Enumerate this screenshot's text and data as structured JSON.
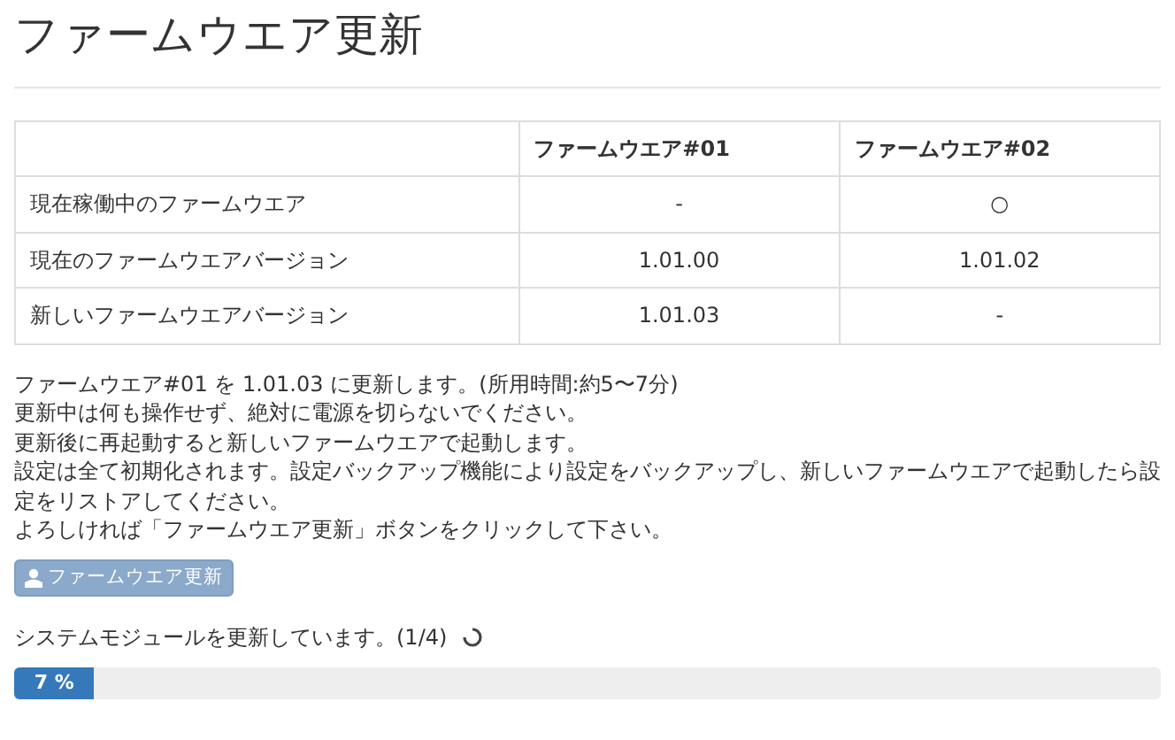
{
  "title": "ファームウエア更新",
  "table": {
    "columns": [
      "ファームウエア#01",
      "ファームウエア#02"
    ],
    "rows": [
      {
        "label": "現在稼働中のファームウエア",
        "cells": [
          "-",
          "○"
        ]
      },
      {
        "label": "現在のファームウエアバージョン",
        "cells": [
          "1.01.00",
          "1.01.02"
        ]
      },
      {
        "label": "新しいファームウエアバージョン",
        "cells": [
          "1.01.03",
          "-"
        ]
      }
    ]
  },
  "notice": [
    "ファームウエア#01 を 1.01.03 に更新します。(所用時間:約5〜7分)",
    "更新中は何も操作せず、絶対に電源を切らないでください。",
    "更新後に再起動すると新しいファームウエアで起動します。",
    "設定は全て初期化されます。設定バックアップ機能により設定をバックアップし、新しいファームウエアで起動したら設定をリストアしてください。",
    "よろしければ「ファームウエア更新」ボタンをクリックして下さい。"
  ],
  "update_button": {
    "label": "ファームウエア更新",
    "disabled": true
  },
  "status": {
    "text": "システムモジュールを更新しています。(1/4)",
    "busy": true
  },
  "progress": {
    "label": "7 %",
    "level": 0.07
  }
}
